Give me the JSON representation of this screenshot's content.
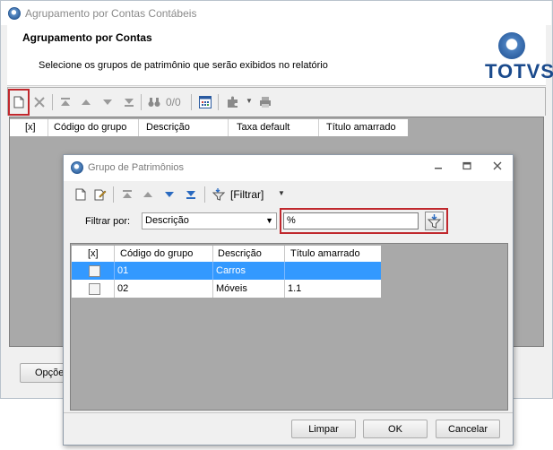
{
  "main_window": {
    "title": "Agrupamento por Contas Contábeis",
    "header_title": "Agrupamento por Contas",
    "header_subtitle": "Selecione os grupos de patrimônio que serão exibidos no relatório",
    "logo_text": "TOTVS",
    "toolbar": {
      "counter": "0/0"
    },
    "grid_columns": [
      "[x]",
      "Código do grupo",
      "Descrição",
      "Taxa default",
      "Título amarrado"
    ],
    "options_button": "Opçõe"
  },
  "dialog": {
    "title": "Grupo de Patrimônios",
    "toolbar": {
      "filter_label": "[Filtrar]"
    },
    "filter_by_label": "Filtrar por:",
    "filter_field_value": "Descrição",
    "filter_text_value": "%",
    "grid": {
      "columns": [
        "[x]",
        "Código do grupo",
        "Descrição",
        "Título amarrado"
      ],
      "rows": [
        {
          "code": "01",
          "description": "Carros",
          "title": "",
          "selected": true
        },
        {
          "code": "02",
          "description": "Móveis",
          "title": "1.1",
          "selected": false
        }
      ]
    },
    "buttons": {
      "clear": "Limpar",
      "ok": "OK",
      "cancel": "Cancelar"
    }
  },
  "colors": {
    "highlight": "#cc2b2b",
    "selected_row": "#3399ff",
    "brand": "#1a4a8c"
  }
}
